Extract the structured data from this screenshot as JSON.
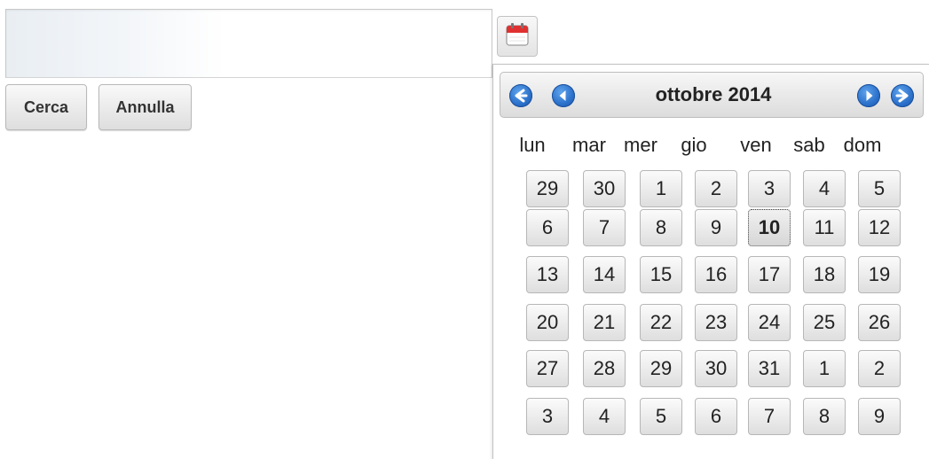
{
  "search": {
    "value": "",
    "placeholder": ""
  },
  "buttons": {
    "cerca": "Cerca",
    "annulla": "Annulla"
  },
  "calendar_trigger": {
    "icon": "calendar-icon"
  },
  "calendar": {
    "title": "ottobre 2014",
    "weekdays": [
      "lun",
      "mar",
      "mer",
      "gio",
      "ven",
      "sab",
      "dom"
    ],
    "weeks": [
      [
        "29",
        "30",
        "1",
        "2",
        "3",
        "4",
        "5"
      ],
      [
        "6",
        "7",
        "8",
        "9",
        "10",
        "11",
        "12"
      ],
      [
        "13",
        "14",
        "15",
        "16",
        "17",
        "18",
        "19"
      ],
      [
        "20",
        "21",
        "22",
        "23",
        "24",
        "25",
        "26"
      ],
      [
        "27",
        "28",
        "29",
        "30",
        "31",
        "1",
        "2"
      ],
      [
        "3",
        "4",
        "5",
        "6",
        "7",
        "8",
        "9"
      ]
    ],
    "selected": {
      "week": 1,
      "day": 4
    },
    "nav_icons": [
      "prev-year-icon",
      "prev-month-icon",
      "next-month-icon",
      "next-year-icon"
    ],
    "colors": {
      "nav": "#2a6fc9",
      "header_bg": "#e2e2e2"
    }
  }
}
